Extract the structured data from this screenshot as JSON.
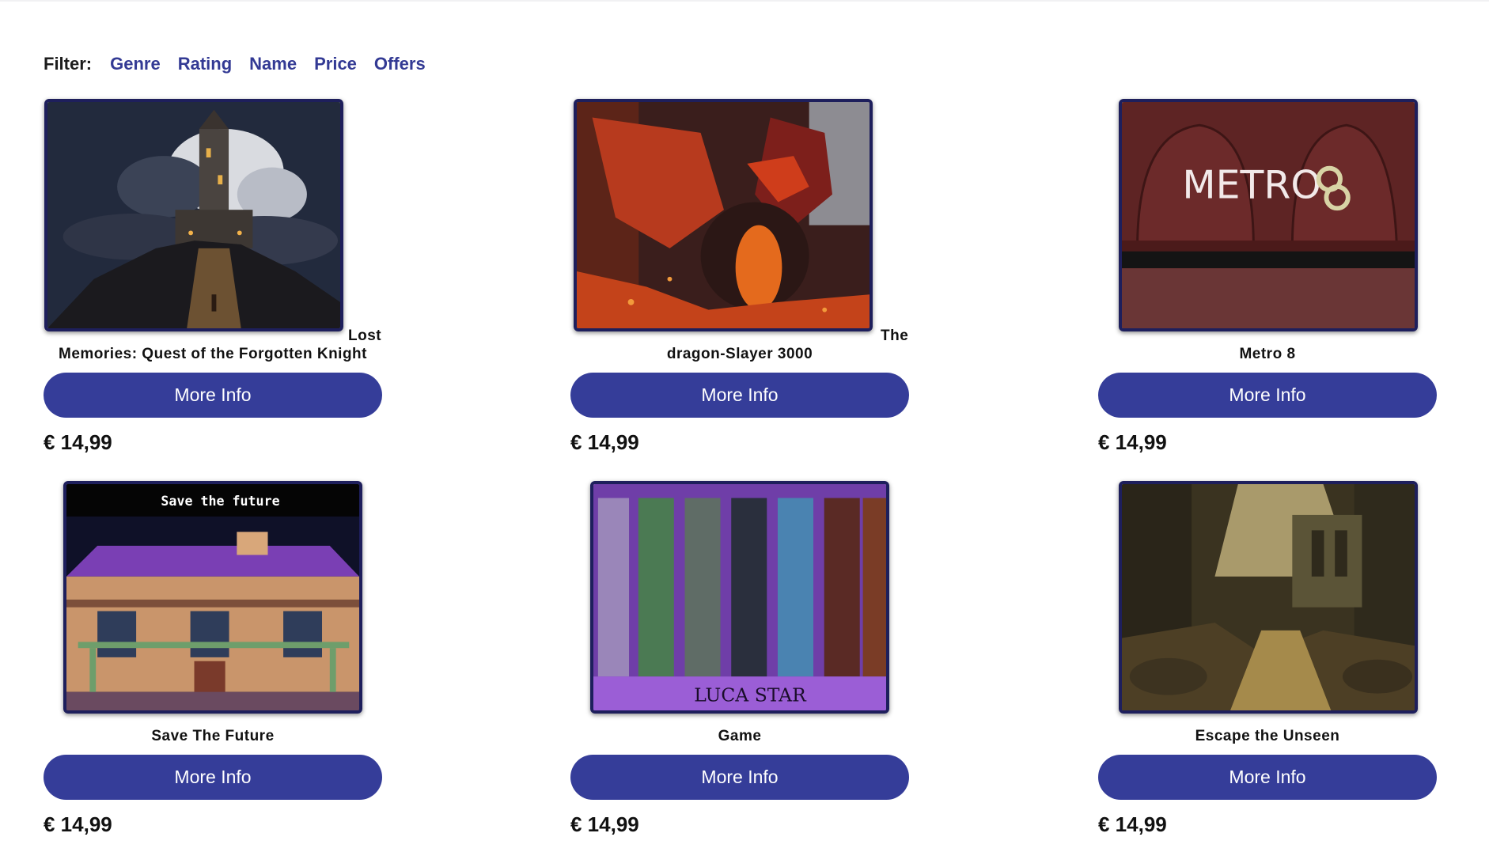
{
  "filter": {
    "label": "Filter:",
    "links": [
      "Genre",
      "Rating",
      "Name",
      "Price",
      "Offers"
    ]
  },
  "games": [
    {
      "title_prefix": "Lost",
      "title": "Memories: Quest of the Forgotten Knight",
      "button": "More Info",
      "price": "€ 14,99",
      "image": "dark-castle-on-hill-image"
    },
    {
      "title_prefix": "The",
      "title": "dragon-Slayer 3000",
      "button": "More Info",
      "price": "€ 14,99",
      "image": "red-dragon-image"
    },
    {
      "title_prefix": "",
      "title": "Metro 8",
      "button": "More Info",
      "price": "€ 14,99",
      "image": "metro-8-logo-image",
      "image_text": "METRO"
    },
    {
      "title_prefix": "",
      "title": "Save The Future",
      "button": "More Info",
      "price": "€ 14,99",
      "image": "purple-mansion-image",
      "image_text": "Save the future"
    },
    {
      "title_prefix": "",
      "title": "Game",
      "button": "More Info",
      "price": "€ 14,99",
      "image": "luca-star-panels-image",
      "image_text": "LUCA STAR"
    },
    {
      "title_prefix": "",
      "title": "Escape the Unseen",
      "button": "More Info",
      "price": "€ 14,99",
      "image": "forest-ruins-image"
    }
  ],
  "colors": {
    "accent": "#353d99",
    "link": "#333a94",
    "thumb_border": "#1e1f5c"
  }
}
